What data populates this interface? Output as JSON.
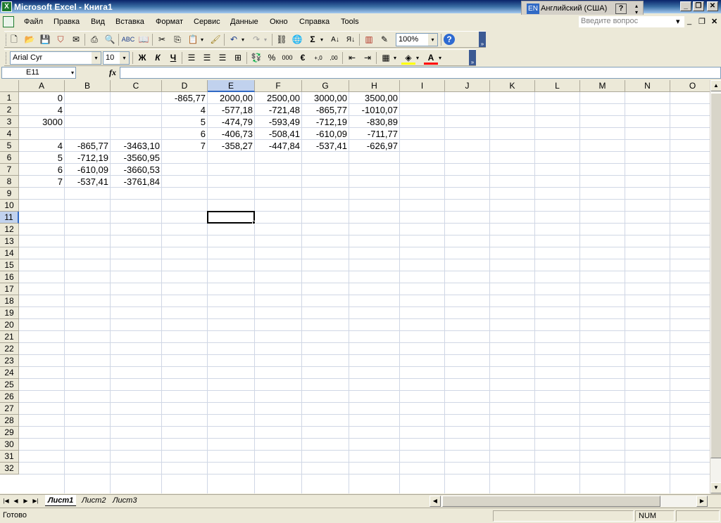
{
  "window": {
    "title": "Microsoft Excel - Книга1",
    "app_icon": "excel-icon"
  },
  "language_bar": {
    "code": "EN",
    "name": "Английский (США)",
    "help": "?"
  },
  "menu": {
    "items": [
      "Файл",
      "Правка",
      "Вид",
      "Вставка",
      "Формат",
      "Сервис",
      "Данные",
      "Окно",
      "Справка",
      "Tools"
    ],
    "question_placeholder": "Введите вопрос"
  },
  "toolbar_standard": {
    "zoom": "100%"
  },
  "toolbar_format": {
    "font": "Arial Cyr",
    "size": "10",
    "bold": "Ж",
    "italic": "К",
    "underline": "Ч",
    "percent": "%",
    "thousands": "000",
    "euro": "€",
    "font_color": "A"
  },
  "formula_bar": {
    "name_box": "E11",
    "fx": "fx",
    "formula": ""
  },
  "sheet": {
    "columns": [
      "A",
      "B",
      "C",
      "D",
      "E",
      "F",
      "G",
      "H",
      "I",
      "J",
      "K",
      "L",
      "M",
      "N",
      "O"
    ],
    "rows": [
      "1",
      "2",
      "3",
      "4",
      "5",
      "6",
      "7",
      "8",
      "9",
      "10",
      "11",
      "12",
      "13",
      "14",
      "15",
      "16",
      "17",
      "18",
      "19",
      "20",
      "21",
      "22",
      "23",
      "24",
      "25",
      "26",
      "27",
      "28",
      "29",
      "30",
      "31",
      "32"
    ],
    "active_cell": "E11",
    "cells": [
      [
        "0",
        "",
        "",
        "-865,77",
        "2000,00",
        "2500,00",
        "3000,00",
        "3500,00"
      ],
      [
        "4",
        "",
        "",
        "4",
        "-577,18",
        "-721,48",
        "-865,77",
        "-1010,07"
      ],
      [
        "3000",
        "",
        "",
        "5",
        "-474,79",
        "-593,49",
        "-712,19",
        "-830,89"
      ],
      [
        "",
        "",
        "",
        "6",
        "-406,73",
        "-508,41",
        "-610,09",
        "-711,77"
      ],
      [
        "4",
        "-865,77",
        "-3463,10",
        "7",
        "-358,27",
        "-447,84",
        "-537,41",
        "-626,97"
      ],
      [
        "5",
        "-712,19",
        "-3560,95",
        "",
        "",
        "",
        "",
        ""
      ],
      [
        "6",
        "-610,09",
        "-3660,53",
        "",
        "",
        "",
        "",
        ""
      ],
      [
        "7",
        "-537,41",
        "-3761,84",
        "",
        "",
        "",
        "",
        ""
      ]
    ]
  },
  "tabs": [
    "Лист1",
    "Лист2",
    "Лист3"
  ],
  "active_tab": "Лист1",
  "status": {
    "text": "Готово",
    "num": "NUM"
  },
  "colors": {
    "title_start": "#0a246a",
    "title_end": "#a6caf0",
    "selection": "#316ac5",
    "chrome": "#ece9d8"
  }
}
